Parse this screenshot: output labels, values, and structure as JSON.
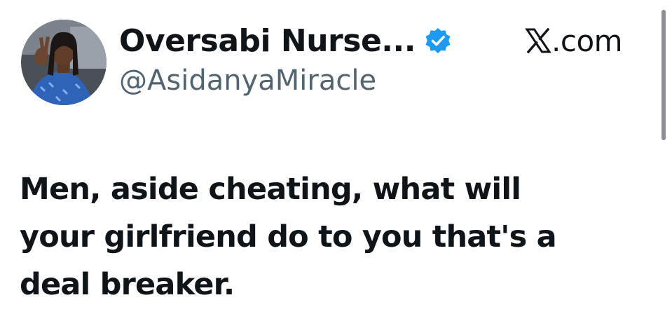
{
  "author": {
    "display_name": "Oversabi Nurse...",
    "handle": "@AsidanyaMiracle",
    "verified": true,
    "avatar_icon": "profile-photo"
  },
  "source": {
    "logo_icon": "x-logo-icon",
    "domain_suffix": ".com"
  },
  "tweet": {
    "lines": [
      "Men, aside cheating, what will",
      "your girlfriend do to you that's a",
      "deal breaker."
    ]
  },
  "colors": {
    "verified_blue": "#1d9bf0",
    "handle_gray": "#536471",
    "text": "#0f1419",
    "scrollbar": "#8e8e93"
  }
}
